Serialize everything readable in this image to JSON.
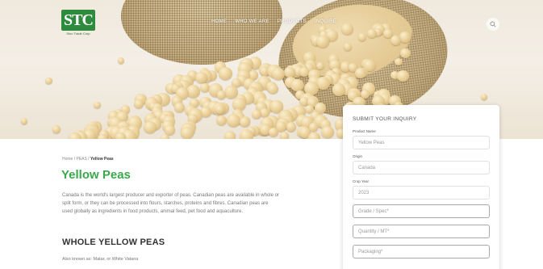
{
  "brand": {
    "logo_text": "STC",
    "logo_caption": "Sino Trade Corp",
    "primary_color": "#3aa84b",
    "logo_color": "#2e8b3e"
  },
  "nav": {
    "items": [
      "Home",
      "Who We Are",
      "Products",
      "Inquire"
    ],
    "search_icon": "search-icon"
  },
  "breadcrumb": {
    "home": "Home",
    "sep": "/",
    "parent": "PEAS",
    "current": "Yellow Peas"
  },
  "page": {
    "title": "Yellow Peas",
    "intro": "Canada is the world's largest producer and exporter of peas. Canadian peas are available in whole or split form, or they can be processed into flours, starches, proteins and fibres. Canadian peas are used globally as ingredients in food products, animal feed, pet food and aquaculture.",
    "section_title": "WHOLE YELLOW PEAS",
    "also_known": "Also known as: Matar, or White Vatana"
  },
  "inquiry": {
    "title": "SUBMIT YOUR INQUIRY",
    "fields": [
      {
        "label": "Product Name",
        "value": "Yellow Peas"
      },
      {
        "label": "Origin",
        "value": "Canada"
      },
      {
        "label": "Crop Year",
        "value": "2023"
      }
    ],
    "placeholders": [
      "Grade / Spec*",
      "Quantity / MT*",
      "Packaging*"
    ]
  }
}
